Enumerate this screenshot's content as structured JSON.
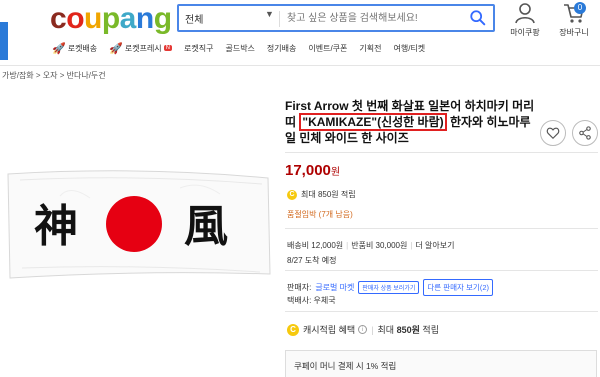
{
  "header": {
    "logo_letters": [
      {
        "ch": "c",
        "color": "#8b2a1f"
      },
      {
        "ch": "o",
        "color": "#e1251b"
      },
      {
        "ch": "u",
        "color": "#f0a500"
      },
      {
        "ch": "p",
        "color": "#7ab929"
      },
      {
        "ch": "a",
        "color": "#3fa9c8"
      },
      {
        "ch": "n",
        "color": "#2a7ad8"
      },
      {
        "ch": "g",
        "color": "#7ab929"
      }
    ],
    "search": {
      "category": "전체",
      "placeholder": "찾고 싶은 상품을 검색해보세요!"
    },
    "my_coupang": "마이쿠팡",
    "cart_label": "장바구니",
    "cart_count": "0"
  },
  "nav": [
    {
      "label": "로켓배송",
      "icon": "rocket"
    },
    {
      "label": "로켓프레시",
      "icon": "rocket-green",
      "badge": "N"
    },
    {
      "label": "로켓직구"
    },
    {
      "label": "골드박스"
    },
    {
      "label": "정기배송"
    },
    {
      "label": "이벤트/쿠폰"
    },
    {
      "label": "기획전"
    },
    {
      "label": "여행/티켓"
    }
  ],
  "breadcrumb": "가방/잡화  >  오자  >  반다나/두건",
  "product": {
    "title_part1": "First Arrow 첫 번째 화살표 일본어 하치마키 머리띠 ",
    "title_highlight": "\"KAMIKAZE\"(신성한 바람)",
    "title_part2": " 한자와 히노마루 일 민체 와이드 한 사이즈",
    "price_value": "17,000",
    "price_unit": "원",
    "reward_text": "최대 850원 적립",
    "stock_text": "품절임박 (7개 남음)",
    "shipping_fee": "배송비 12,000원",
    "return_fee": "반품비 30,000원",
    "more": "더 알아보기",
    "delivery_date": "8/27 도착 예정",
    "seller_label": "판매자:",
    "seller_name": "글로벌 마켓",
    "seller_button": "판매자 상품 보러가기",
    "other_sellers": "다른 판매자 보기(2)",
    "courier": "택배사: 우체국",
    "cash_label": "캐시적립 혜택",
    "cash_max": "최대",
    "cash_amount": "850원",
    "cash_suffix": "적립",
    "coupay_text": "쿠페이 머니 결제 시 1% 적립",
    "image_kanji_left": "神",
    "image_kanji_right": "風"
  },
  "colors": {
    "accent": "#346aff",
    "price": "#ae0000",
    "highlight_border": "#e02020",
    "rising_sun": "#e60012"
  }
}
